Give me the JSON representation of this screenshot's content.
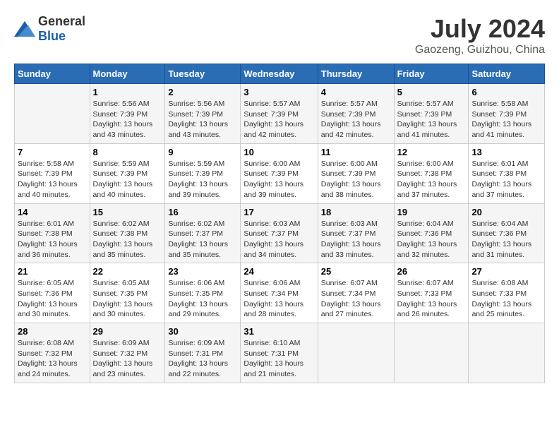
{
  "header": {
    "logo_general": "General",
    "logo_blue": "Blue",
    "title": "July 2024",
    "subtitle": "Gaozeng, Guizhou, China"
  },
  "days_of_week": [
    "Sunday",
    "Monday",
    "Tuesday",
    "Wednesday",
    "Thursday",
    "Friday",
    "Saturday"
  ],
  "weeks": [
    [
      {
        "day": "",
        "sunrise": "",
        "sunset": "",
        "daylight": ""
      },
      {
        "day": "1",
        "sunrise": "Sunrise: 5:56 AM",
        "sunset": "Sunset: 7:39 PM",
        "daylight": "Daylight: 13 hours and 43 minutes."
      },
      {
        "day": "2",
        "sunrise": "Sunrise: 5:56 AM",
        "sunset": "Sunset: 7:39 PM",
        "daylight": "Daylight: 13 hours and 43 minutes."
      },
      {
        "day": "3",
        "sunrise": "Sunrise: 5:57 AM",
        "sunset": "Sunset: 7:39 PM",
        "daylight": "Daylight: 13 hours and 42 minutes."
      },
      {
        "day": "4",
        "sunrise": "Sunrise: 5:57 AM",
        "sunset": "Sunset: 7:39 PM",
        "daylight": "Daylight: 13 hours and 42 minutes."
      },
      {
        "day": "5",
        "sunrise": "Sunrise: 5:57 AM",
        "sunset": "Sunset: 7:39 PM",
        "daylight": "Daylight: 13 hours and 41 minutes."
      },
      {
        "day": "6",
        "sunrise": "Sunrise: 5:58 AM",
        "sunset": "Sunset: 7:39 PM",
        "daylight": "Daylight: 13 hours and 41 minutes."
      }
    ],
    [
      {
        "day": "7",
        "sunrise": "Sunrise: 5:58 AM",
        "sunset": "Sunset: 7:39 PM",
        "daylight": "Daylight: 13 hours and 40 minutes."
      },
      {
        "day": "8",
        "sunrise": "Sunrise: 5:59 AM",
        "sunset": "Sunset: 7:39 PM",
        "daylight": "Daylight: 13 hours and 40 minutes."
      },
      {
        "day": "9",
        "sunrise": "Sunrise: 5:59 AM",
        "sunset": "Sunset: 7:39 PM",
        "daylight": "Daylight: 13 hours and 39 minutes."
      },
      {
        "day": "10",
        "sunrise": "Sunrise: 6:00 AM",
        "sunset": "Sunset: 7:39 PM",
        "daylight": "Daylight: 13 hours and 39 minutes."
      },
      {
        "day": "11",
        "sunrise": "Sunrise: 6:00 AM",
        "sunset": "Sunset: 7:39 PM",
        "daylight": "Daylight: 13 hours and 38 minutes."
      },
      {
        "day": "12",
        "sunrise": "Sunrise: 6:00 AM",
        "sunset": "Sunset: 7:38 PM",
        "daylight": "Daylight: 13 hours and 37 minutes."
      },
      {
        "day": "13",
        "sunrise": "Sunrise: 6:01 AM",
        "sunset": "Sunset: 7:38 PM",
        "daylight": "Daylight: 13 hours and 37 minutes."
      }
    ],
    [
      {
        "day": "14",
        "sunrise": "Sunrise: 6:01 AM",
        "sunset": "Sunset: 7:38 PM",
        "daylight": "Daylight: 13 hours and 36 minutes."
      },
      {
        "day": "15",
        "sunrise": "Sunrise: 6:02 AM",
        "sunset": "Sunset: 7:38 PM",
        "daylight": "Daylight: 13 hours and 35 minutes."
      },
      {
        "day": "16",
        "sunrise": "Sunrise: 6:02 AM",
        "sunset": "Sunset: 7:37 PM",
        "daylight": "Daylight: 13 hours and 35 minutes."
      },
      {
        "day": "17",
        "sunrise": "Sunrise: 6:03 AM",
        "sunset": "Sunset: 7:37 PM",
        "daylight": "Daylight: 13 hours and 34 minutes."
      },
      {
        "day": "18",
        "sunrise": "Sunrise: 6:03 AM",
        "sunset": "Sunset: 7:37 PM",
        "daylight": "Daylight: 13 hours and 33 minutes."
      },
      {
        "day": "19",
        "sunrise": "Sunrise: 6:04 AM",
        "sunset": "Sunset: 7:36 PM",
        "daylight": "Daylight: 13 hours and 32 minutes."
      },
      {
        "day": "20",
        "sunrise": "Sunrise: 6:04 AM",
        "sunset": "Sunset: 7:36 PM",
        "daylight": "Daylight: 13 hours and 31 minutes."
      }
    ],
    [
      {
        "day": "21",
        "sunrise": "Sunrise: 6:05 AM",
        "sunset": "Sunset: 7:36 PM",
        "daylight": "Daylight: 13 hours and 30 minutes."
      },
      {
        "day": "22",
        "sunrise": "Sunrise: 6:05 AM",
        "sunset": "Sunset: 7:35 PM",
        "daylight": "Daylight: 13 hours and 30 minutes."
      },
      {
        "day": "23",
        "sunrise": "Sunrise: 6:06 AM",
        "sunset": "Sunset: 7:35 PM",
        "daylight": "Daylight: 13 hours and 29 minutes."
      },
      {
        "day": "24",
        "sunrise": "Sunrise: 6:06 AM",
        "sunset": "Sunset: 7:34 PM",
        "daylight": "Daylight: 13 hours and 28 minutes."
      },
      {
        "day": "25",
        "sunrise": "Sunrise: 6:07 AM",
        "sunset": "Sunset: 7:34 PM",
        "daylight": "Daylight: 13 hours and 27 minutes."
      },
      {
        "day": "26",
        "sunrise": "Sunrise: 6:07 AM",
        "sunset": "Sunset: 7:33 PM",
        "daylight": "Daylight: 13 hours and 26 minutes."
      },
      {
        "day": "27",
        "sunrise": "Sunrise: 6:08 AM",
        "sunset": "Sunset: 7:33 PM",
        "daylight": "Daylight: 13 hours and 25 minutes."
      }
    ],
    [
      {
        "day": "28",
        "sunrise": "Sunrise: 6:08 AM",
        "sunset": "Sunset: 7:32 PM",
        "daylight": "Daylight: 13 hours and 24 minutes."
      },
      {
        "day": "29",
        "sunrise": "Sunrise: 6:09 AM",
        "sunset": "Sunset: 7:32 PM",
        "daylight": "Daylight: 13 hours and 23 minutes."
      },
      {
        "day": "30",
        "sunrise": "Sunrise: 6:09 AM",
        "sunset": "Sunset: 7:31 PM",
        "daylight": "Daylight: 13 hours and 22 minutes."
      },
      {
        "day": "31",
        "sunrise": "Sunrise: 6:10 AM",
        "sunset": "Sunset: 7:31 PM",
        "daylight": "Daylight: 13 hours and 21 minutes."
      },
      {
        "day": "",
        "sunrise": "",
        "sunset": "",
        "daylight": ""
      },
      {
        "day": "",
        "sunrise": "",
        "sunset": "",
        "daylight": ""
      },
      {
        "day": "",
        "sunrise": "",
        "sunset": "",
        "daylight": ""
      }
    ]
  ]
}
